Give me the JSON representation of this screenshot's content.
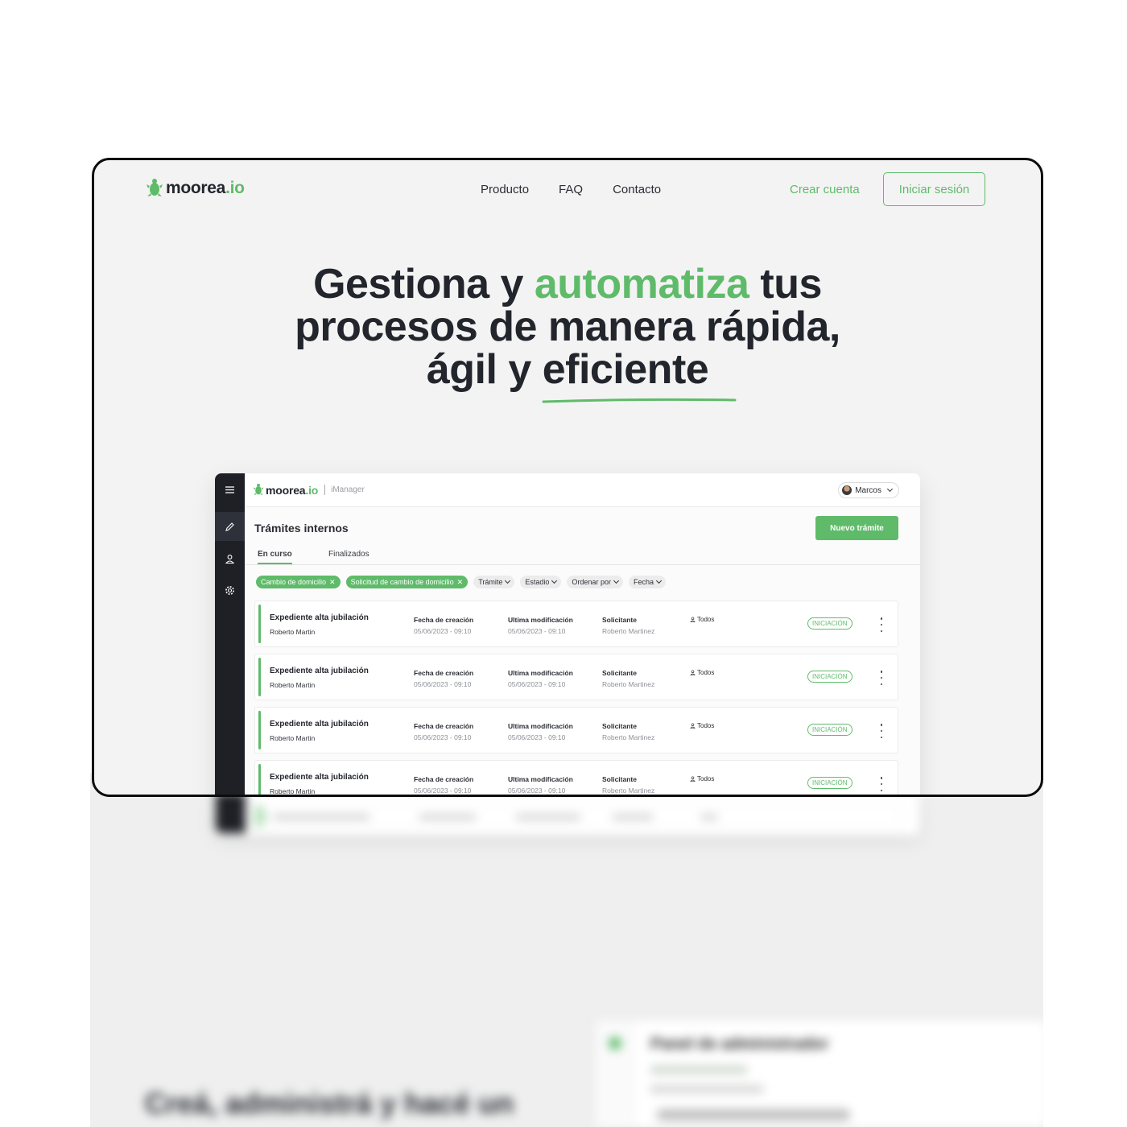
{
  "site": {
    "logo": {
      "name": "moorea",
      "tld": ".io"
    },
    "nav": [
      "Producto",
      "FAQ",
      "Contacto"
    ],
    "create_account": "Crear cuenta",
    "login": "Iniciar sesión"
  },
  "hero": {
    "line1_a": "Gestiona y ",
    "line1_highlight": "automatiza",
    "line1_b": " tus",
    "line2": "procesos de manera rápida,",
    "line3": "ágil y eficiente"
  },
  "app": {
    "logo": {
      "name": "moorea",
      "tld": ".io"
    },
    "subtitle": "iManager",
    "user": "Marcos",
    "page_title": "Trámites internos",
    "new_button": "Nuevo trámite",
    "tabs": [
      "En curso",
      "Finalizados"
    ],
    "active_filters": [
      "Cambio de domicilio",
      "Solicitud de cambio de domicilio"
    ],
    "filter_dropdowns": [
      "Trámite",
      "Estadio",
      "Ordenar por",
      "Fecha"
    ],
    "sidebar_icons": [
      "menu-icon",
      "pencil-icon",
      "user-icon",
      "gear-icon"
    ],
    "rows": [
      {
        "title": "Expediente alta jubilación",
        "owner": "Roberto Martin",
        "created_label": "Fecha de creación",
        "created": "05/06/2023 - 09:10",
        "modified_label": "Ultima modificación",
        "modified": "05/06/2023 - 09:10",
        "applicant_label": "Solicitante",
        "applicant": "Roberto Martinez",
        "scope": "Todos",
        "status": "INICIACIÓN"
      },
      {
        "title": "Expediente alta jubilación",
        "owner": "Roberto Martin",
        "created_label": "Fecha de creación",
        "created": "05/06/2023 - 09:10",
        "modified_label": "Ultima modificación",
        "modified": "05/06/2023 - 09:10",
        "applicant_label": "Solicitante",
        "applicant": "Roberto Martinez",
        "scope": "Todos",
        "status": "INICIACIÓN"
      },
      {
        "title": "Expediente alta jubilación",
        "owner": "Roberto Martin",
        "created_label": "Fecha de creación",
        "created": "05/06/2023 - 09:10",
        "modified_label": "Ultima modificación",
        "modified": "05/06/2023 - 09:10",
        "applicant_label": "Solicitante",
        "applicant": "Roberto Martinez",
        "scope": "Todos",
        "status": "INICIACIÓN"
      },
      {
        "title": "Expediente alta jubilación",
        "owner": "Roberto Martin",
        "created_label": "Fecha de creación",
        "created": "05/06/2023 - 09:10",
        "modified_label": "Ultima modificación",
        "modified": "05/06/2023 - 09:10",
        "applicant_label": "Solicitante",
        "applicant": "Roberto Martinez",
        "scope": "Todos",
        "status": "INICIACIÓN"
      }
    ]
  },
  "below": {
    "heading": "Creá, administrá y hacé un",
    "panel_title": "Panel de administrador"
  },
  "colors": {
    "accent": "#5fbb6a",
    "dark": "#22252c",
    "sidebar": "#1e2026",
    "background": "#f3f3f3"
  }
}
